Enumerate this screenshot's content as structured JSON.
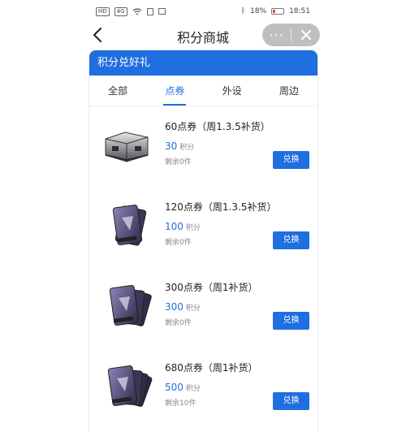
{
  "statusbar": {
    "left_icons": [
      "HD",
      "4G",
      "wifi-icon",
      "sim-icon",
      "photo-icon"
    ],
    "battery": "18%",
    "time": "18:51"
  },
  "titlebar": {
    "title": "积分商城",
    "more": "···"
  },
  "banner": {
    "text": "积分兑好礼"
  },
  "tabs": [
    {
      "label": "全部"
    },
    {
      "label": "点券",
      "active": true
    },
    {
      "label": "外设"
    },
    {
      "label": "周边"
    }
  ],
  "items": [
    {
      "name": "60点券（周1.3.5补货）",
      "points": "30",
      "unit": "积分",
      "stock": "剩余0件",
      "button": "兑换",
      "image": "silver-case"
    },
    {
      "name": "120点券（周1.3.5补货）",
      "points": "100",
      "unit": "积分",
      "stock": "剩余0件",
      "button": "兑换",
      "image": "card-stack"
    },
    {
      "name": "300点券（周1补货）",
      "points": "300",
      "unit": "积分",
      "stock": "剩余0件",
      "button": "兑换",
      "image": "card-stack"
    },
    {
      "name": "680点券（周1补货）",
      "points": "500",
      "unit": "积分",
      "stock": "剩余10件",
      "button": "兑换",
      "image": "card-stack"
    }
  ],
  "colors": {
    "accent": "#1f6fe0",
    "capsule": "#bfbfbf"
  }
}
